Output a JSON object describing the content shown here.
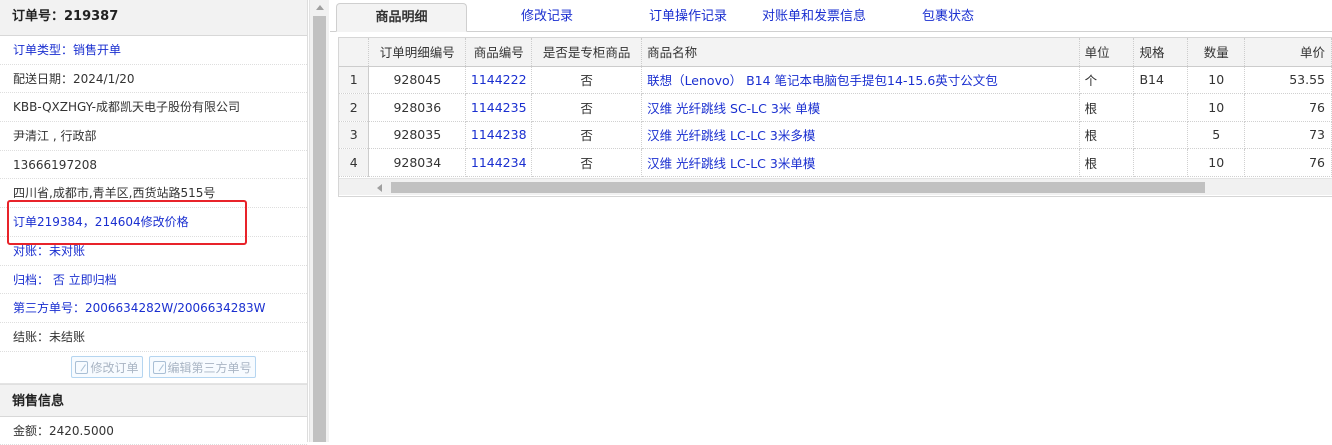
{
  "order": {
    "title": "订单号：219387",
    "rows": [
      {
        "text": "订单类型：销售开单",
        "style": "blue"
      },
      {
        "text": "配送日期：2024/1/20",
        "style": "dark"
      },
      {
        "text": "KBB-QXZHGY-成都凯天电子股份有限公司",
        "style": "dark"
      },
      {
        "text": "尹清江 , 行政部",
        "style": "dark"
      },
      {
        "text": "13666197208",
        "style": "dark"
      },
      {
        "text": "四川省,成都市,青羊区,西货站路515号",
        "style": "dark"
      },
      {
        "text": "订单219384，214604修改价格",
        "style": "blue"
      },
      {
        "text": "对账：未对账",
        "style": "blue"
      },
      {
        "text": "归档： 否 立即归档",
        "style": "blue"
      },
      {
        "text": "第三方单号：2006634282W/2006634283W",
        "style": "blue"
      },
      {
        "text": "结账：未结账",
        "style": "dark"
      }
    ],
    "buttons": {
      "modify_order": "修改订单",
      "edit_third_party": "编辑第三方单号"
    }
  },
  "sales": {
    "title": "销售信息",
    "amount": "金额：2420.5000"
  },
  "tabs": [
    {
      "label": "商品明细",
      "active": true
    },
    {
      "label": "修改记录",
      "active": false
    },
    {
      "label": "订单操作记录",
      "active": false
    },
    {
      "label": "对账单和发票信息",
      "active": false
    },
    {
      "label": "包裹状态",
      "active": false
    }
  ],
  "table": {
    "headers": [
      "",
      "订单明细编号",
      "商品编号",
      "是否是专柜商品",
      "商品名称",
      "单位",
      "规格",
      "数量",
      "单价"
    ],
    "rows": [
      {
        "rn": "1",
        "detail_id": "928045",
        "product_id": "1144222",
        "counter": "否",
        "name": "联想（Lenovo） B14 笔记本电脑包手提包14-15.6英寸公文包",
        "unit": "个",
        "spec": "B14",
        "qty": "10",
        "price": "53.55"
      },
      {
        "rn": "2",
        "detail_id": "928036",
        "product_id": "1144235",
        "counter": "否",
        "name": "汉维 光纤跳线 SC-LC 3米 单模",
        "unit": "根",
        "spec": "",
        "qty": "10",
        "price": "76"
      },
      {
        "rn": "3",
        "detail_id": "928035",
        "product_id": "1144238",
        "counter": "否",
        "name": "汉维 光纤跳线 LC-LC 3米多模",
        "unit": "根",
        "spec": "",
        "qty": "5",
        "price": "73"
      },
      {
        "rn": "4",
        "detail_id": "928034",
        "product_id": "1144234",
        "counter": "否",
        "name": "汉维 光纤跳线 LC-LC 3米单模",
        "unit": "根",
        "spec": "",
        "qty": "10",
        "price": "76"
      }
    ]
  },
  "colors": {
    "link": "#1a2fd0",
    "highlight_border": "#e8232a"
  }
}
